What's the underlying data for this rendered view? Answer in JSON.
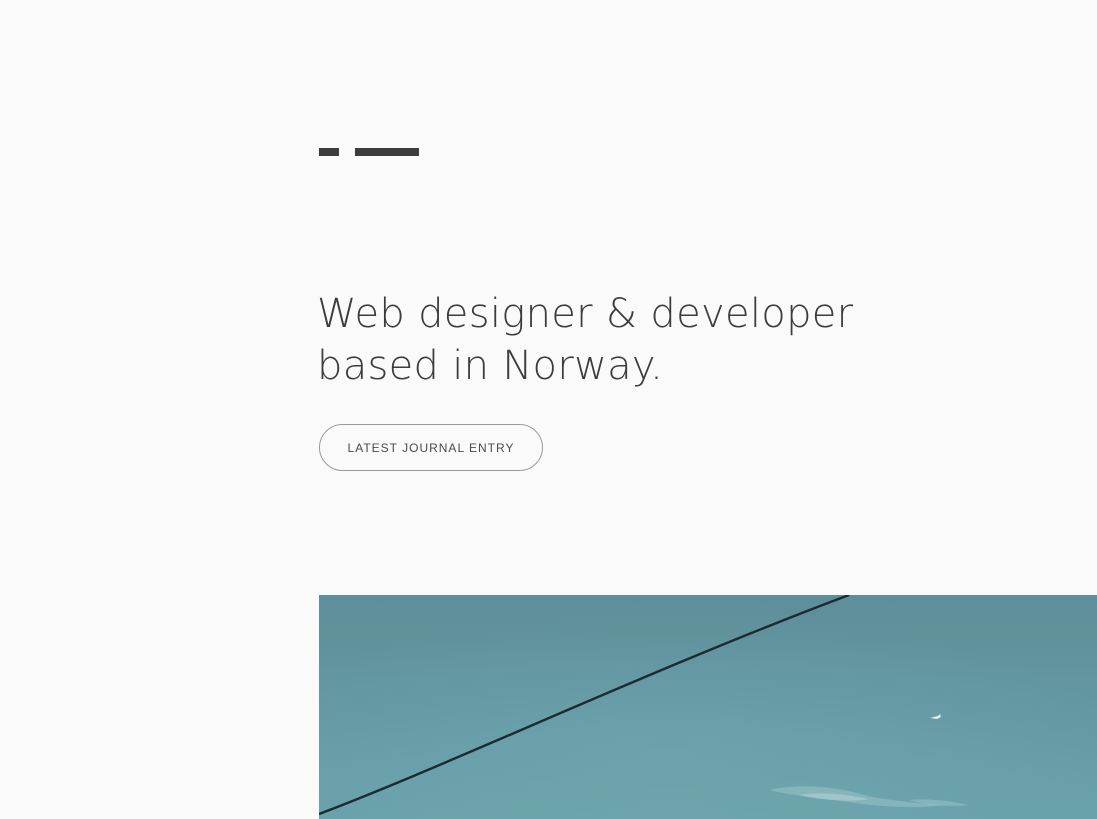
{
  "header": {
    "logo_icon": "two-bar-logo-icon"
  },
  "hero": {
    "headline_line1": "Web designer & developer",
    "headline_line2": "based in Norway.",
    "button_label": "LATEST JOURNAL ENTRY"
  },
  "image": {
    "icon": "sky-with-power-line-photo",
    "colors": {
      "sky": "#6399a3",
      "wire": "#1d2a33"
    }
  },
  "colors": {
    "background": "#fafafa",
    "text": "#3c3c3c",
    "logo": "#3d3d3d",
    "button_border": "#9a9a9a"
  }
}
